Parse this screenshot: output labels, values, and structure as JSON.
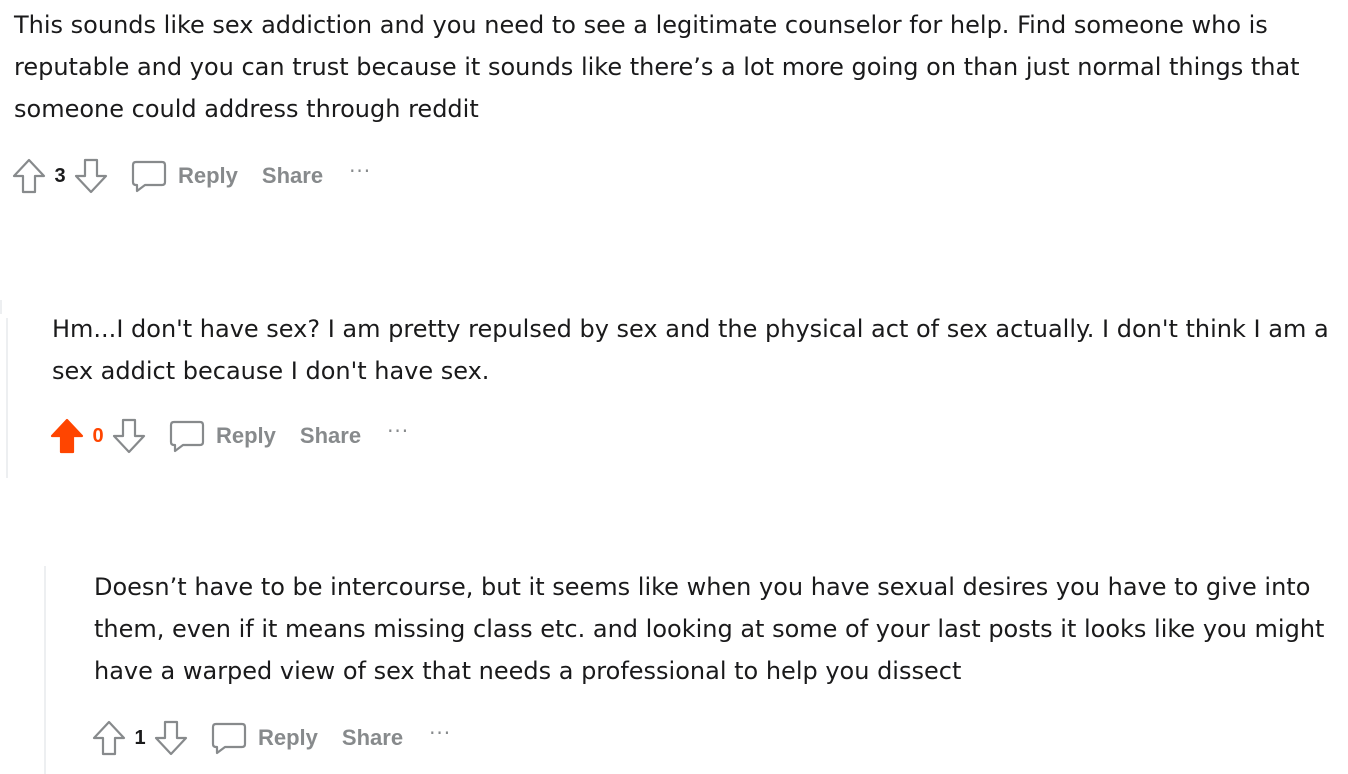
{
  "comments": [
    {
      "text": "This sounds like sex addiction and you need to see a legitimate counselor for help. Find someone who is reputable and you can trust because it sounds like there’s a lot more going on than just normal things that someone could address through reddit",
      "score": "3",
      "upvoted": false,
      "reply_label": "Reply",
      "share_label": "Share",
      "more_label": "···"
    },
    {
      "text": "Hm...I don't have sex? I am pretty repulsed by sex and the physical act of sex actually. I don't think I am a sex addict because I don't have sex.",
      "score": "0",
      "upvoted": true,
      "reply_label": "Reply",
      "share_label": "Share",
      "more_label": "···"
    },
    {
      "text": "Doesn’t have to be intercourse, but it seems like when you have sexual desires you have to give into them, even if it means missing class etc. and looking at some of your last posts it looks like you might have a warped view of sex that needs a professional to help you dissect",
      "score": "1",
      "upvoted": false,
      "reply_label": "Reply",
      "share_label": "Share",
      "more_label": "···"
    }
  ],
  "colors": {
    "upvote_active": "#ff4500",
    "icon_gray": "#878a8c",
    "thread_line": "#edeff1"
  }
}
